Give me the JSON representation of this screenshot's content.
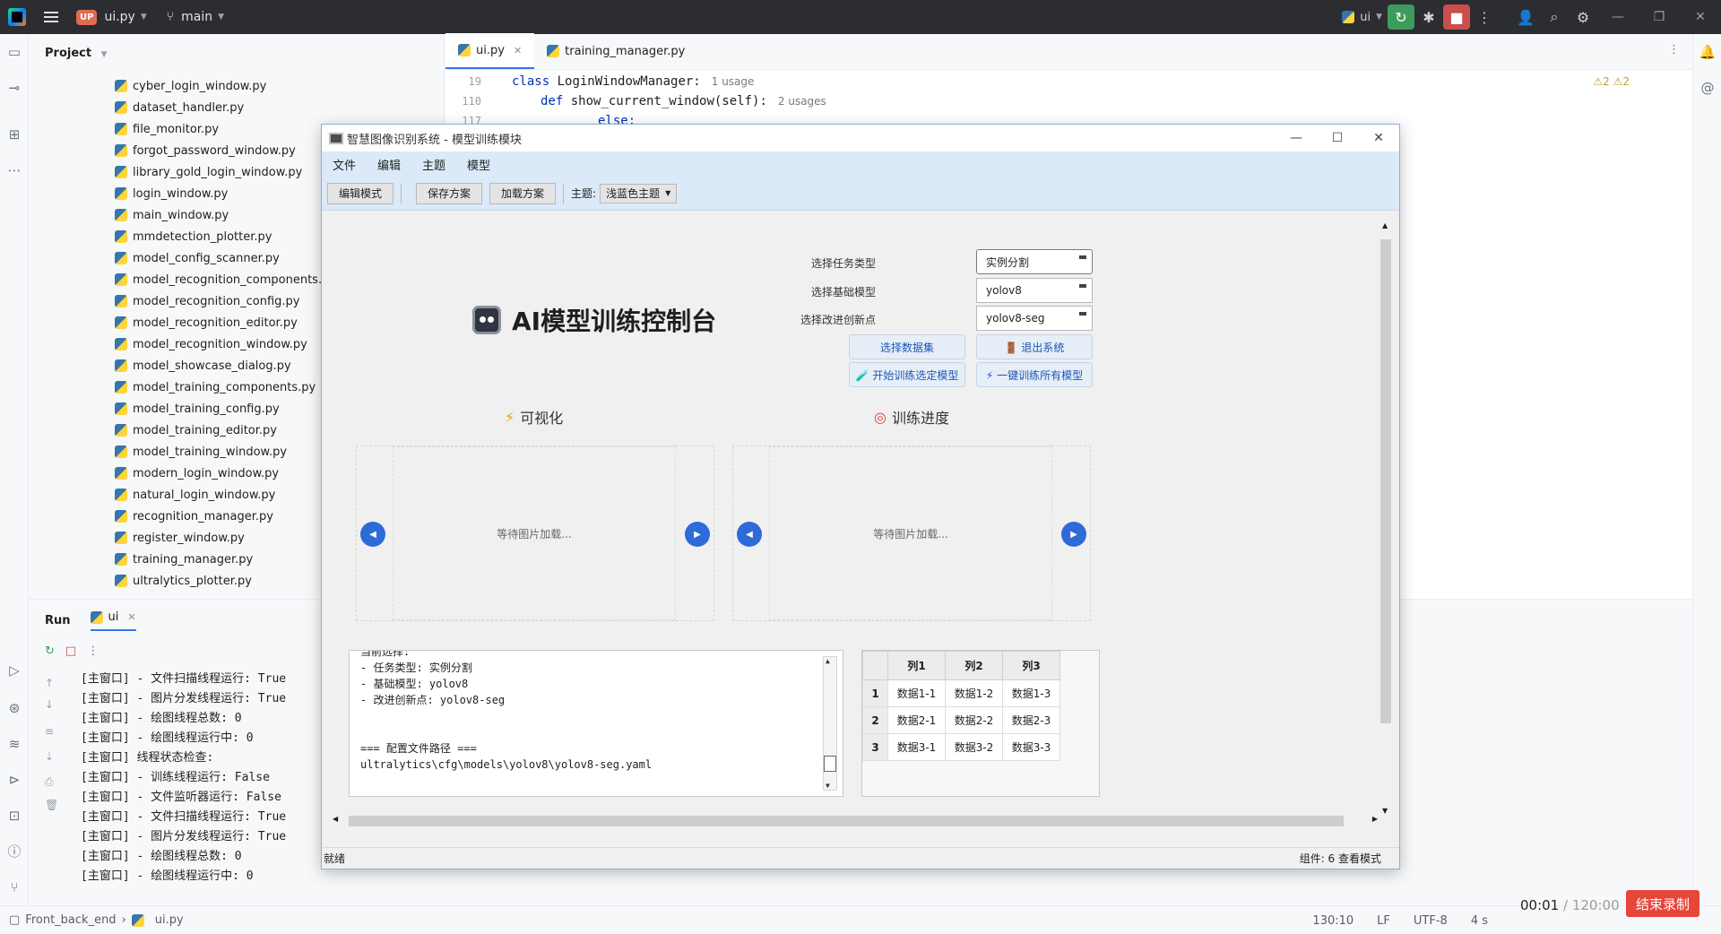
{
  "ide": {
    "project_badge": "UP",
    "project_name": "ui.py",
    "branch": "main",
    "run_config": "ui",
    "project_panel_title": "Project",
    "files": [
      "cyber_login_window.py",
      "dataset_handler.py",
      "file_monitor.py",
      "forgot_password_window.py",
      "library_gold_login_window.py",
      "login_window.py",
      "main_window.py",
      "mmdetection_plotter.py",
      "model_config_scanner.py",
      "model_recognition_components.py",
      "model_recognition_config.py",
      "model_recognition_editor.py",
      "model_recognition_window.py",
      "model_showcase_dialog.py",
      "model_training_components.py",
      "model_training_config.py",
      "model_training_editor.py",
      "model_training_window.py",
      "modern_login_window.py",
      "natural_login_window.py",
      "recognition_manager.py",
      "register_window.py",
      "training_manager.py",
      "ultralytics_plotter.py"
    ],
    "editor_tabs": [
      {
        "label": "ui.py"
      },
      {
        "label": "training_manager.py"
      }
    ],
    "code": [
      {
        "ln": "19",
        "kw": "class",
        "text": "LoginWindowManager:",
        "usage": "1 usage"
      },
      {
        "ln": "110",
        "kw": "def",
        "text": "show_current_window(self):",
        "usage": "2 usages"
      },
      {
        "ln": "117",
        "kw": "",
        "text": "else:",
        "usage": ""
      }
    ],
    "warnings": "⚠2 ⚠2",
    "run_title": "Run",
    "run_tab": "ui",
    "console": [
      "[主窗口] - 文件扫描线程运行: True",
      "[主窗口] - 图片分发线程运行: True",
      "[主窗口] - 绘图线程总数: 0",
      "[主窗口] - 绘图线程运行中: 0",
      "[主窗口] 线程状态检查:",
      "[主窗口] - 训练线程运行: False",
      "[主窗口] - 文件监听器运行: False",
      "[主窗口] - 文件扫描线程运行: True",
      "[主窗口] - 图片分发线程运行: True",
      "[主窗口] - 绘图线程总数: 0",
      "[主窗口] - 绘图线程运行中: 0"
    ],
    "status": {
      "crumb_root": "Front_back_end",
      "crumb_file": "ui.py",
      "position": "130:10",
      "line_sep": "LF",
      "encoding": "UTF-8",
      "indent": "4 s"
    }
  },
  "recording": {
    "elapsed": "00:01",
    "total": "/ 120:00",
    "stop_label": "结束录制"
  },
  "app": {
    "title": "智慧图像识别系统 - 模型训练模块",
    "menu": [
      "文件",
      "编辑",
      "主题",
      "模型"
    ],
    "toolbar": {
      "edit_mode": "编辑模式",
      "save_plan": "保存方案",
      "load_plan": "加载方案",
      "theme_label": "主题:",
      "theme_value": "浅蓝色主题"
    },
    "main_title": "AI模型训练控制台",
    "form": [
      {
        "label": "选择任务类型",
        "value": "实例分割"
      },
      {
        "label": "选择基础模型",
        "value": "yolov8"
      },
      {
        "label": "选择改进创新点",
        "value": "yolov8-seg"
      }
    ],
    "buttons": {
      "select_dataset": "选择数据集",
      "exit_system": "🚪 退出系统",
      "start_training": "🧪 开始训练选定模型",
      "train_all": "⚡ 一键训练所有模型"
    },
    "sections": {
      "visualization": "可视化",
      "progress": "训练进度"
    },
    "image_placeholder": "等待图片加载...",
    "log": [
      "当前选择:",
      "- 任务类型: 实例分割",
      "- 基础模型: yolov8",
      "- 改进创新点: yolov8-seg",
      "",
      "",
      "=== 配置文件路径 ===",
      "ultralytics\\cfg\\models\\yolov8\\yolov8-seg.yaml"
    ],
    "table": {
      "headers": [
        "列1",
        "列2",
        "列3"
      ],
      "rows": [
        {
          "index": "1",
          "cells": [
            "数据1-1",
            "数据1-2",
            "数据1-3"
          ]
        },
        {
          "index": "2",
          "cells": [
            "数据2-1",
            "数据2-2",
            "数据2-3"
          ]
        },
        {
          "index": "3",
          "cells": [
            "数据3-1",
            "数据3-2",
            "数据3-3"
          ]
        }
      ]
    },
    "status_left": "就绪",
    "status_right": "组件: 6  查看模式"
  }
}
